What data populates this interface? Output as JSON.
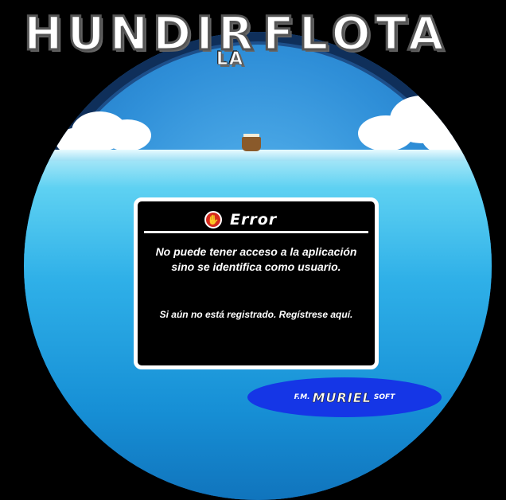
{
  "title": {
    "word1": "HUNDIR",
    "word2": "LA",
    "word3": "FLOTA"
  },
  "dialog": {
    "icon": "stop-hand-icon",
    "title": "Error",
    "message_line1": "No puede tener acceso a la aplicación",
    "message_line2": "sino se identifica como usuario.",
    "register_link": "Si aún no está registrado. Regístrese aquí."
  },
  "credit": {
    "prefix": "F.M.",
    "name": "MURIEL",
    "suffix": "SOFT"
  },
  "colors": {
    "background": "#000000",
    "sea": "#2fb0e8",
    "stop_icon": "#d62a1e",
    "credit_ellipse": "#1536e6"
  }
}
